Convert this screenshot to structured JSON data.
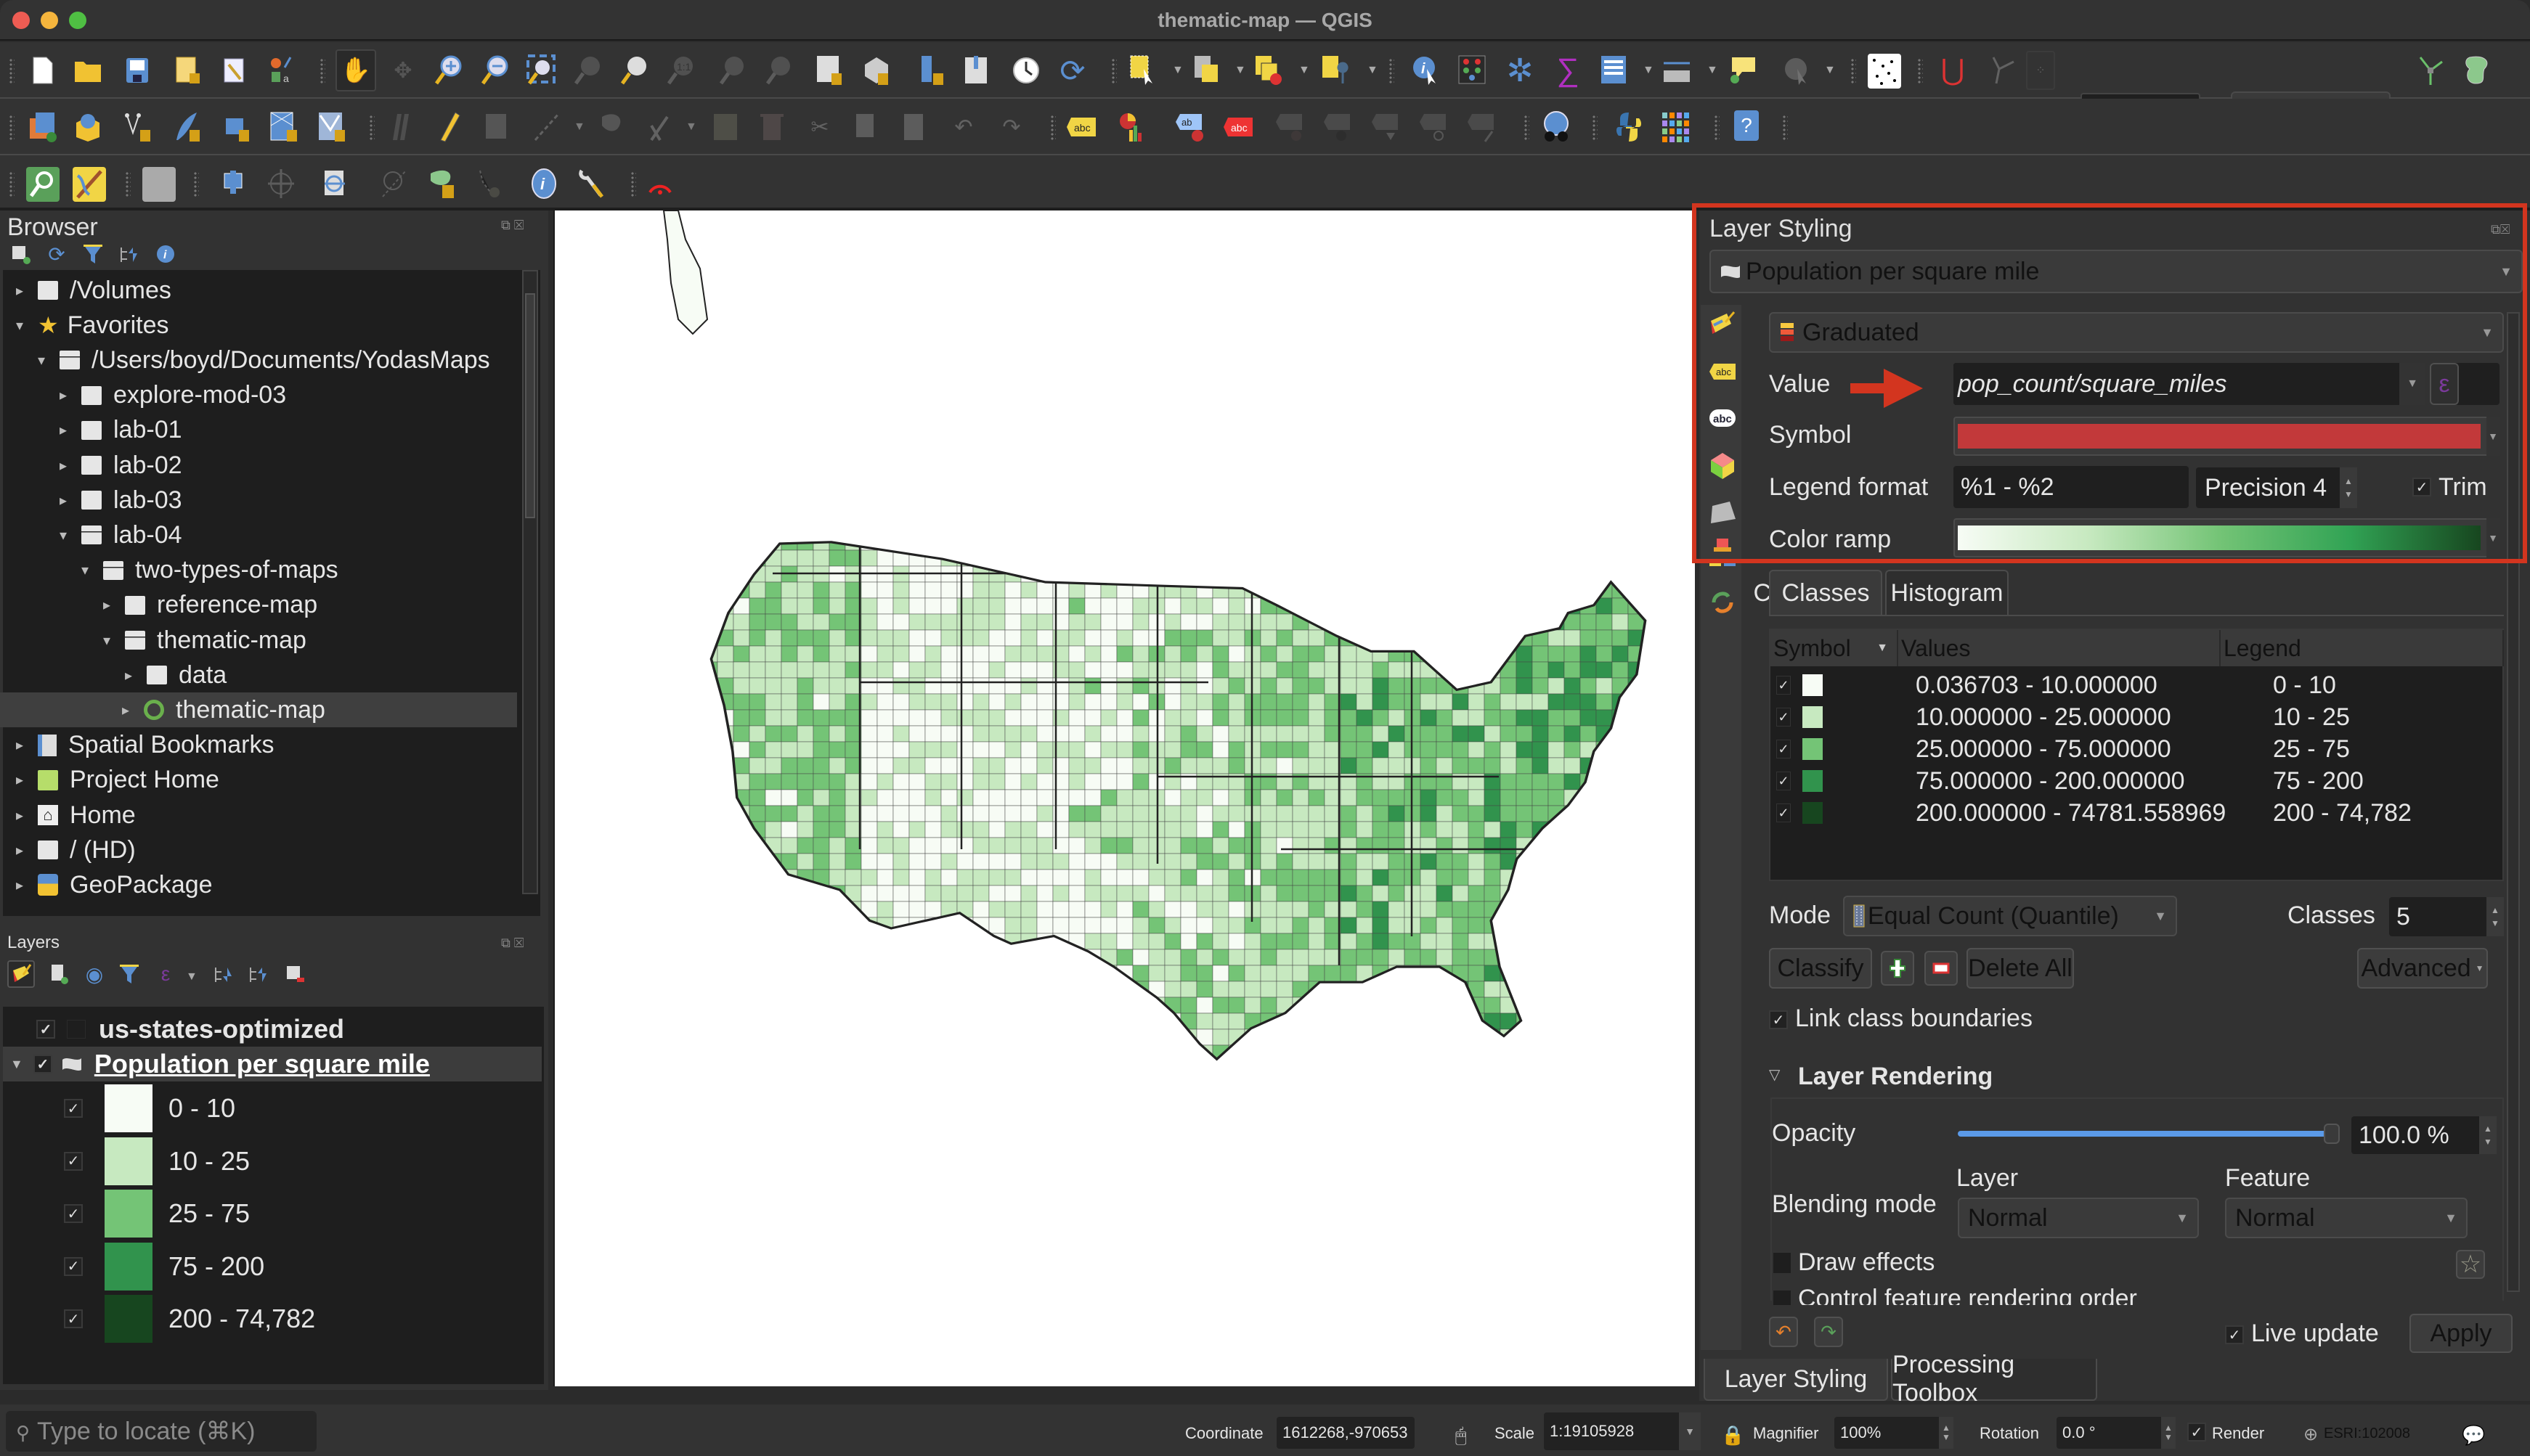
{
  "window": {
    "title": "thematic-map — QGIS"
  },
  "toolbar": {
    "snap_tolerance": "12",
    "snap_unit": "px",
    "row1_icons": [
      "new-project",
      "open-project",
      "save-project",
      "new-print-layout",
      "style-manager",
      "digitize-style",
      "pan",
      "pan-to-selection",
      "zoom-in",
      "zoom-out",
      "zoom-full",
      "zoom-to-selection",
      "zoom-to-layer",
      "zoom-native",
      "zoom-last",
      "zoom-next",
      "new-map-view",
      "new-3d-view",
      "new-bookmark",
      "show-bookmarks",
      "temporal-controller",
      "refresh",
      "select-features",
      "select-by-value",
      "deselect",
      "select-by-location",
      "identify",
      "attribute-table",
      "settings",
      "statistics",
      "open-field-calculator",
      "measure",
      "map-tips",
      "run-feature-action",
      "snapping-grid",
      "snapping",
      "topological-editing",
      "snapping-type",
      "tracing",
      "shape-digitizing"
    ],
    "row2_icons": [
      "data-source-manager",
      "new-geopackage-layer",
      "new-shapefile",
      "new-spatialite-layer",
      "new-temporary-layer",
      "new-virtual-layer",
      "new-mesh-layer",
      "current-edits",
      "toggle-editing",
      "save-edits",
      "add-line",
      "vertex-tool",
      "digitize-with-curve",
      "delete-selected",
      "cut-features",
      "copy-features",
      "paste-features",
      "undo",
      "redo",
      "label-toolbar",
      "diagram-toolbar",
      "pin-labels",
      "show-labels",
      "highlight-pinned",
      "move-label",
      "rotate-label",
      "change-label",
      "label-properties",
      "metasearch",
      "python-console",
      "plugins",
      "help"
    ],
    "row3_icons": [
      "locator",
      "georeferencer",
      "raster-calc",
      "add-ring",
      "add-part",
      "vertex-editor",
      "offset-curve",
      "fill-ring",
      "reshape",
      "identify-info",
      "processing-tools",
      "gps"
    ]
  },
  "browser": {
    "title": "Browser",
    "toolbar_icons": [
      "add-selected-layers",
      "refresh",
      "filter",
      "collapse-all",
      "properties"
    ],
    "items": [
      {
        "label": "/Volumes",
        "level": 0,
        "expanded": false,
        "icon": "folder"
      },
      {
        "label": "Favorites",
        "level": 0,
        "expanded": true,
        "icon": "star"
      },
      {
        "label": "/Users/boyd/Documents/YodasMaps",
        "level": 1,
        "expanded": true,
        "icon": "folder-open"
      },
      {
        "label": "explore-mod-03",
        "level": 2,
        "expanded": false,
        "icon": "folder"
      },
      {
        "label": "lab-01",
        "level": 2,
        "expanded": false,
        "icon": "folder"
      },
      {
        "label": "lab-02",
        "level": 2,
        "expanded": false,
        "icon": "folder"
      },
      {
        "label": "lab-03",
        "level": 2,
        "expanded": false,
        "icon": "folder"
      },
      {
        "label": "lab-04",
        "level": 2,
        "expanded": true,
        "icon": "folder-open"
      },
      {
        "label": "two-types-of-maps",
        "level": 3,
        "expanded": true,
        "icon": "folder-open"
      },
      {
        "label": "reference-map",
        "level": 4,
        "expanded": false,
        "icon": "folder"
      },
      {
        "label": "thematic-map",
        "level": 4,
        "expanded": true,
        "icon": "folder-open"
      },
      {
        "label": "data",
        "level": 5,
        "expanded": false,
        "icon": "folder"
      },
      {
        "label": "thematic-map",
        "level": 5,
        "expanded": false,
        "icon": "qgis-project",
        "selected": true
      },
      {
        "label": "Spatial Bookmarks",
        "level": 0,
        "expanded": false,
        "icon": "bookmark"
      },
      {
        "label": "Project Home",
        "level": 0,
        "expanded": false,
        "icon": "project-home"
      },
      {
        "label": "Home",
        "level": 0,
        "expanded": false,
        "icon": "home"
      },
      {
        "label": "/ (HD)",
        "level": 0,
        "expanded": false,
        "icon": "folder"
      },
      {
        "label": "GeoPackage",
        "level": 0,
        "expanded": false,
        "icon": "geopackage"
      }
    ]
  },
  "layers": {
    "title": "Layers",
    "toolbar_icons": [
      "open-layer-styling",
      "add-group",
      "manage-visibility",
      "filter-legend",
      "filter-by-expression",
      "expand-all",
      "collapse-all",
      "remove-layer"
    ],
    "items": [
      {
        "name": "us-states-optimized",
        "checked": true
      },
      {
        "name": "Population per square mile",
        "checked": true,
        "expanded": true,
        "active": true
      }
    ],
    "legend": [
      {
        "label": "0 - 10",
        "color": "#f7fcf5",
        "checked": true
      },
      {
        "label": "10 - 25",
        "color": "#c7e9c0",
        "checked": true
      },
      {
        "label": "25 - 75",
        "color": "#74c476",
        "checked": true
      },
      {
        "label": "75 - 200",
        "color": "#31934d",
        "checked": true
      },
      {
        "label": "200 - 74,782",
        "color": "#17461f",
        "checked": true
      }
    ]
  },
  "locator": {
    "placeholder": "Type to locate (⌘K)"
  },
  "map": {
    "description": "US counties choropleth — population per square mile",
    "background": "#ffffff"
  },
  "styling": {
    "title": "Layer Styling",
    "layer": "Population per square mile",
    "renderer": "Graduated",
    "value_label": "Value",
    "value": "pop_count/square_miles",
    "symbol_label": "Symbol",
    "symbol_color": "#c2393a",
    "legend_format_label": "Legend format",
    "legend_format": "%1 - %2",
    "precision": "Precision 4",
    "trim_label": "Trim",
    "trim_checked": true,
    "color_ramp_label": "Color ramp",
    "color_ramp": [
      "#f7fcf5",
      "#c7e9c0",
      "#74c476",
      "#31a354",
      "#17461f"
    ],
    "tabs": [
      "Classes",
      "Histogram"
    ],
    "active_tab": "Classes",
    "table_headers": [
      "Symbol",
      "Values",
      "Legend"
    ],
    "classes": [
      {
        "values": "0.036703 - 10.000000",
        "legend": "0 - 10",
        "color": "#f7fcf5",
        "checked": true
      },
      {
        "values": "10.000000 - 25.000000",
        "legend": "10 - 25",
        "color": "#c7e9c0",
        "checked": true
      },
      {
        "values": "25.000000 - 75.000000",
        "legend": "25 - 75",
        "color": "#74c476",
        "checked": true
      },
      {
        "values": "75.000000 - 200.000000",
        "legend": "75 - 200",
        "color": "#31934d",
        "checked": true
      },
      {
        "values": "200.000000 - 74781.558969",
        "legend": "200 - 74,782",
        "color": "#17461f",
        "checked": true
      }
    ],
    "mode_label": "Mode",
    "mode": "Equal Count (Quantile)",
    "classes_label": "Classes",
    "classes_count": "5",
    "classify_label": "Classify",
    "delete_all_label": "Delete All",
    "advanced_label": "Advanced",
    "link_boundaries_label": "Link class boundaries",
    "link_boundaries_checked": true,
    "layer_rendering_label": "Layer Rendering",
    "opacity_label": "Opacity",
    "opacity_value": "100.0 %",
    "opacity_fraction": 1.0,
    "blending_label": "Blending mode",
    "blend_layer_label": "Layer",
    "blend_feature_label": "Feature",
    "blend_layer": "Normal",
    "blend_feature": "Normal",
    "draw_effects_label": "Draw effects",
    "draw_effects_checked": false,
    "control_order_label": "Control feature rendering order",
    "live_update_label": "Live update",
    "live_update_checked": true,
    "apply_label": "Apply",
    "bottom_tabs": [
      "Layer Styling",
      "Processing Toolbox"
    ],
    "active_bottom_tab": "Layer Styling"
  },
  "statusbar": {
    "coordinate_label": "Coordinate",
    "coordinate": "1612268,-970653",
    "scale_label": "Scale",
    "scale": "1:19105928",
    "magnifier_label": "Magnifier",
    "magnifier": "100%",
    "rotation_label": "Rotation",
    "rotation": "0.0 °",
    "render_label": "Render",
    "render_checked": true,
    "crs": "ESRI:102008"
  }
}
